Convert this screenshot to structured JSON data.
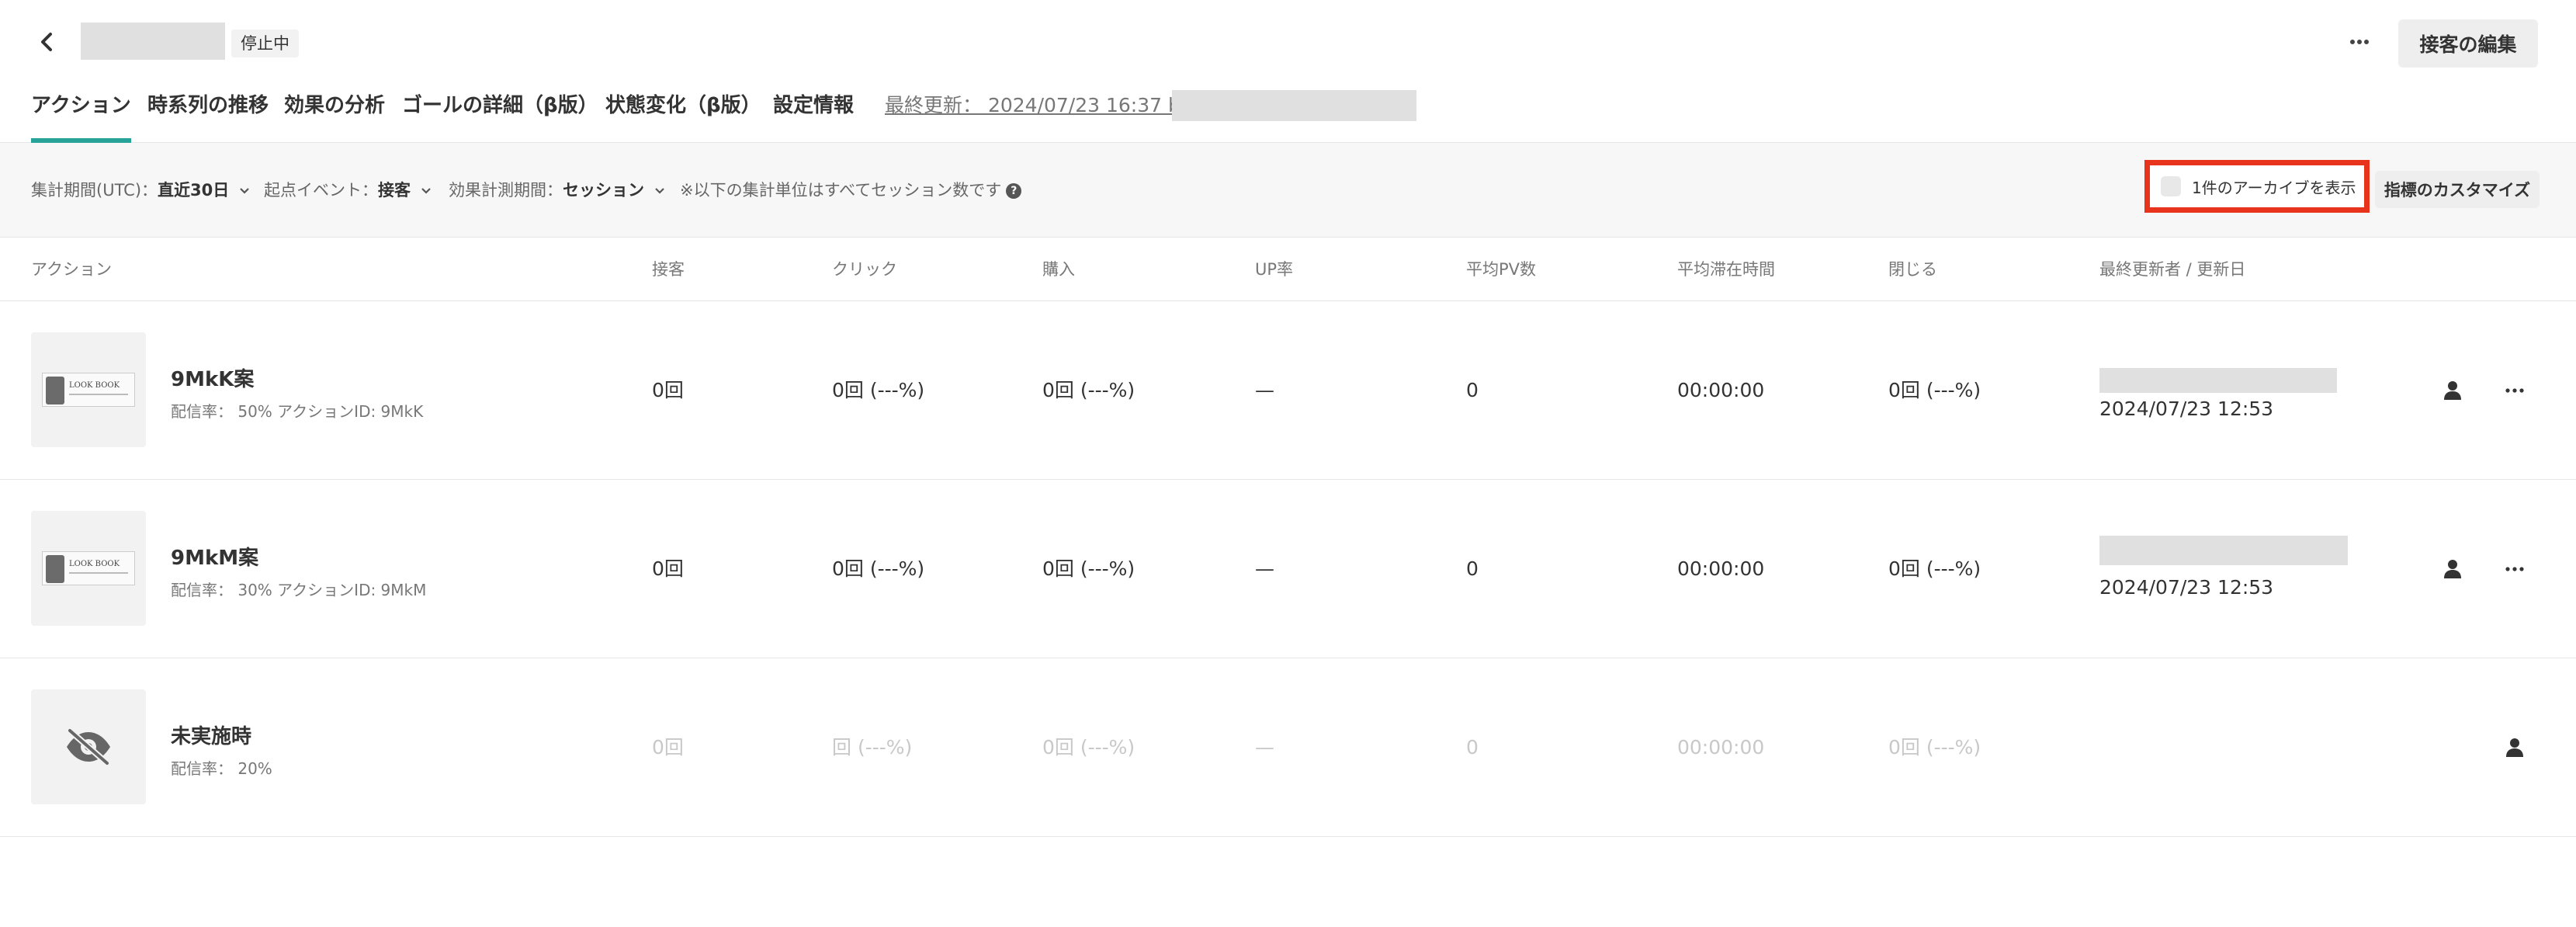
{
  "header": {
    "status": "停止中",
    "edit_label": "接客の編集"
  },
  "tabs": [
    {
      "label": "アクション",
      "active": true
    },
    {
      "label": "時系列の推移"
    },
    {
      "label": "効果の分析"
    },
    {
      "label": "ゴールの詳細（β版）"
    },
    {
      "label": "状態変化（β版）"
    },
    {
      "label": "設定情報"
    }
  ],
  "last_updated": "最終更新： 2024/07/23 16:37 by",
  "filters": {
    "period_label": "集計期間(UTC)：",
    "period_value": "直近30日",
    "event_label": "起点イベント：",
    "event_value": "接客",
    "measure_label": "効果計測期間：",
    "measure_value": "セッション",
    "note": "※以下の集計単位はすべてセッション数です",
    "archive_label": "1件のアーカイブを表示",
    "customize_label": "指標のカスタマイズ"
  },
  "columns": [
    "アクション",
    "接客",
    "クリック",
    "購入",
    "UP率",
    "平均PV数",
    "平均滞在時間",
    "閉じる",
    "最終更新者 / 更新日"
  ],
  "rows": [
    {
      "name": "9MkK案",
      "meta": "配信率： 50% アクションID: 9MkK",
      "banner_text": "LOOK BOOK",
      "serve": "0回",
      "click": "0回 (---%)",
      "purchase": "0回 (---%)",
      "up_rate": "—",
      "avg_pv": "0",
      "avg_time": "00:00:00",
      "close": "0回 (---%)",
      "updated": "2024/07/23 12:53"
    },
    {
      "name": "9MkM案",
      "meta": "配信率： 30% アクションID: 9MkM",
      "banner_text": "LOOK BOOK",
      "serve": "0回",
      "click": "0回 (---%)",
      "purchase": "0回 (---%)",
      "up_rate": "—",
      "avg_pv": "0",
      "avg_time": "00:00:00",
      "close": "0回 (---%)",
      "updated": "2024/07/23 12:53"
    },
    {
      "name": "未実施時",
      "meta": "配信率： 20%",
      "serve": "0回",
      "click": "回 (---%)",
      "purchase": "0回 (---%)",
      "up_rate": "—",
      "avg_pv": "0",
      "avg_time": "00:00:00",
      "close": "0回 (---%)"
    }
  ],
  "colors": {
    "accent": "#27a39a",
    "highlight_border": "#e8341c"
  }
}
